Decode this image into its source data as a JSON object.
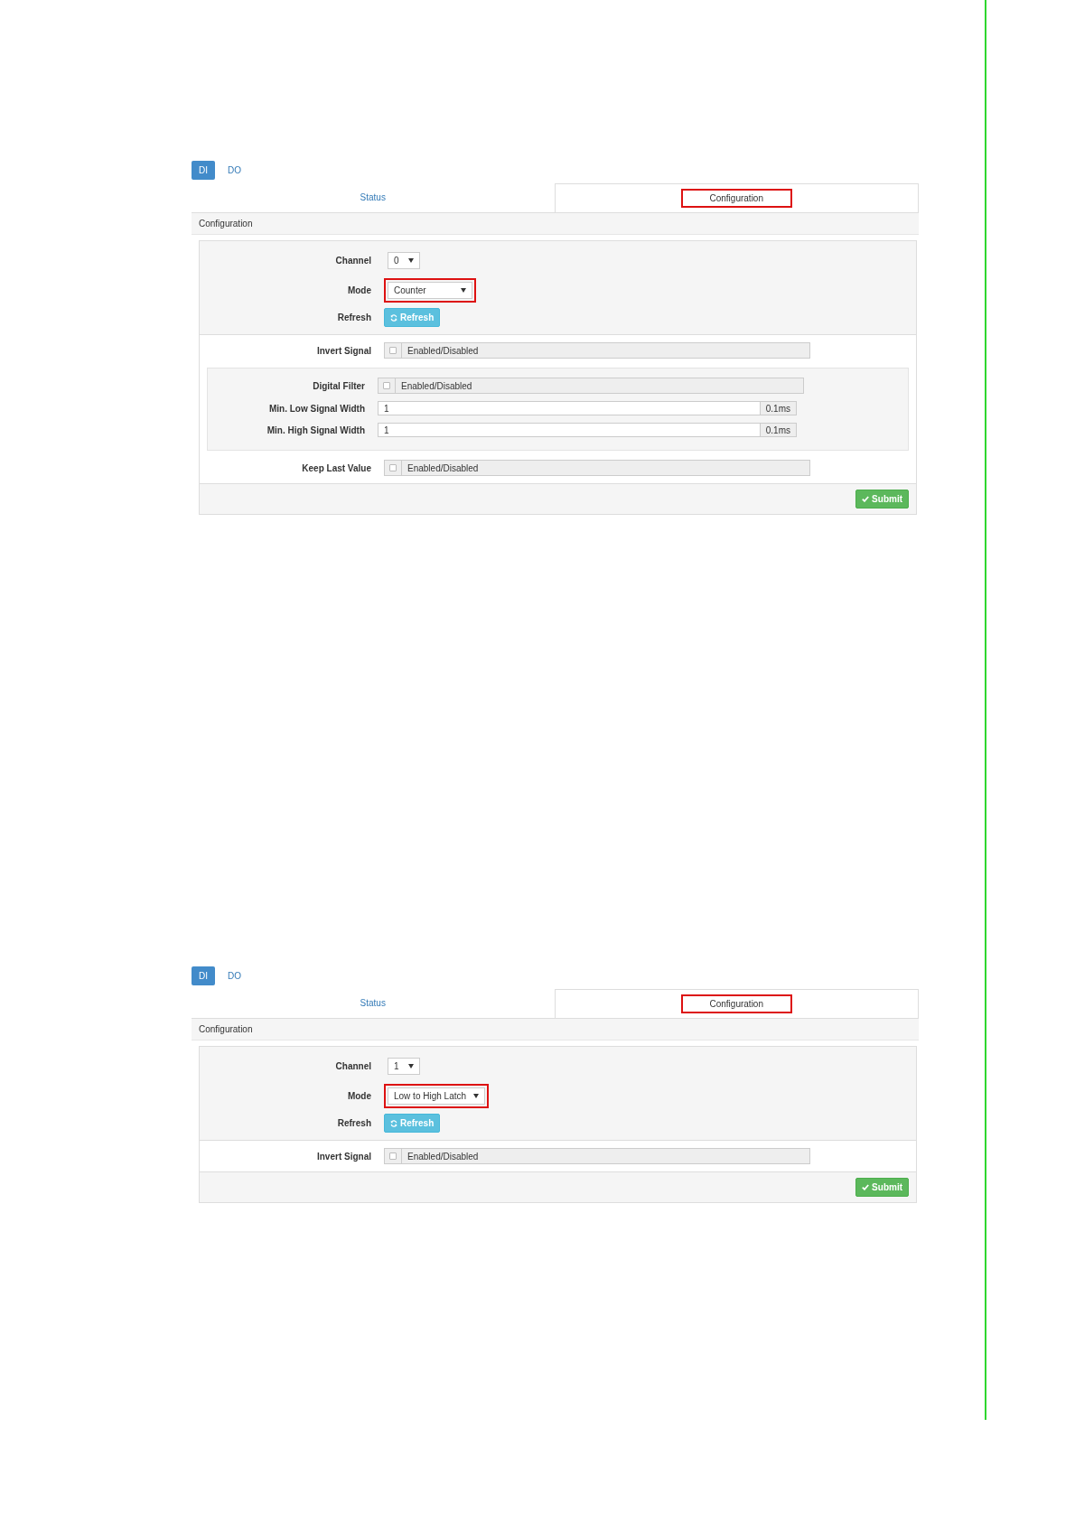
{
  "panels": [
    {
      "nav": [
        {
          "label": "DI",
          "selected": true
        },
        {
          "label": "DO",
          "selected": false
        }
      ],
      "tabs": [
        {
          "label": "Status",
          "selected": false,
          "highlighted": false
        },
        {
          "label": "Configuration",
          "selected": true,
          "highlighted": true
        }
      ],
      "section_title": "Configuration",
      "channel": {
        "label": "Channel",
        "value": "0"
      },
      "mode": {
        "label": "Mode",
        "value": "Counter",
        "highlighted": true
      },
      "refresh": {
        "label": "Refresh",
        "button": "Refresh"
      },
      "rows": [
        {
          "kind": "toggle",
          "label": "Invert Signal",
          "text": "Enabled/Disabled",
          "checked": false
        },
        {
          "kind": "group",
          "children": [
            {
              "kind": "toggle",
              "label": "Digital Filter",
              "text": "Enabled/Disabled",
              "checked": false
            },
            {
              "kind": "input",
              "label": "Min. Low Signal Width",
              "value": "1",
              "unit": "0.1ms"
            },
            {
              "kind": "input",
              "label": "Min. High Signal Width",
              "value": "1",
              "unit": "0.1ms"
            }
          ]
        },
        {
          "kind": "toggle",
          "label": "Keep Last Value",
          "text": "Enabled/Disabled",
          "checked": false
        }
      ],
      "submit": "Submit"
    },
    {
      "nav": [
        {
          "label": "DI",
          "selected": true
        },
        {
          "label": "DO",
          "selected": false
        }
      ],
      "tabs": [
        {
          "label": "Status",
          "selected": false,
          "highlighted": false
        },
        {
          "label": "Configuration",
          "selected": true,
          "highlighted": true
        }
      ],
      "section_title": "Configuration",
      "channel": {
        "label": "Channel",
        "value": "1"
      },
      "mode": {
        "label": "Mode",
        "value": "Low to High Latch",
        "highlighted": true
      },
      "refresh": {
        "label": "Refresh",
        "button": "Refresh"
      },
      "rows": [
        {
          "kind": "toggle",
          "label": "Invert Signal",
          "text": "Enabled/Disabled",
          "checked": false
        }
      ],
      "submit": "Submit"
    }
  ]
}
